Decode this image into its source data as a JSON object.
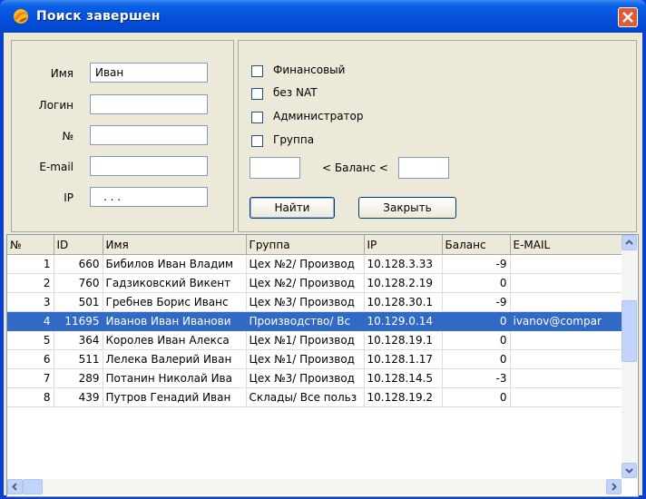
{
  "window": {
    "title": "Поиск завершен",
    "accent": "#0054e3",
    "close_icon": "close-icon",
    "app_icon": "app-icon"
  },
  "form": {
    "labels": {
      "name": "Имя",
      "login": "Логин",
      "number": "№",
      "email": "E-mail",
      "ip": "IP"
    },
    "values": {
      "name": "Иван",
      "login": "",
      "number": "",
      "email": "",
      "ip": ". . ."
    },
    "checkboxes": [
      "Финансовый",
      "без NAT",
      "Администратор",
      "Группа"
    ],
    "balance_label": "< Баланс <",
    "balance_min": "",
    "balance_max": "",
    "find_button": "Найти",
    "close_button": "Закрыть"
  },
  "table": {
    "columns": [
      "№",
      "ID",
      "Имя",
      "Группа",
      "IP",
      "Баланс",
      "E-MAIL"
    ],
    "selected_row": 3,
    "rows": [
      [
        "1",
        "660",
        "Бибилов Иван Владим",
        "Цех №2/ Производ",
        "10.128.3.33",
        "-9",
        ""
      ],
      [
        "2",
        "760",
        "Гадзиковский Викент",
        "Цех №2/ Производ",
        "10.128.2.19",
        "0",
        ""
      ],
      [
        "3",
        "501",
        "Гребнев Борис Иванс",
        "Цех №3/ Производ",
        "10.128.30.1",
        "-9",
        ""
      ],
      [
        "4",
        "11695",
        "Иванов Иван Иванови",
        "Производство/ Вс",
        "10.129.0.14",
        "0",
        "ivanov@compar"
      ],
      [
        "5",
        "364",
        "Королев Иван Алекса",
        "Цех №1/ Производ",
        "10.128.19.1",
        "0",
        ""
      ],
      [
        "6",
        "511",
        "Лелека Валерий Иван",
        "Цех №1/ Производ",
        "10.128.1.17",
        "0",
        ""
      ],
      [
        "7",
        "289",
        "Потанин Николай Ива",
        "Цех №3/ Производ",
        "10.128.14.5",
        "-3",
        ""
      ],
      [
        "8",
        "439",
        "Путров Генадий Иван",
        "Склады/ Все польз",
        "10.128.19.2",
        "0",
        ""
      ]
    ]
  }
}
